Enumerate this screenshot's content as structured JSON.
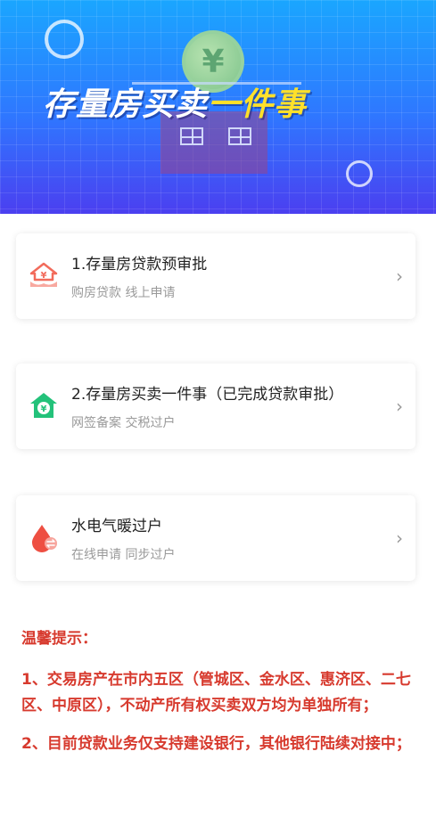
{
  "banner": {
    "title_main": "存量房买卖",
    "title_accent": "一件事",
    "icons": [
      "yuan-coin-icon",
      "house-icon"
    ]
  },
  "services": [
    {
      "title": "1.存量房贷款预审批",
      "subtitle": "购房贷款 线上申请",
      "icon": "house-loan-icon",
      "icon_color": "#f26b5b"
    },
    {
      "title": "2.存量房买卖一件事（已完成贷款审批）",
      "subtitle": "网签备案 交税过户",
      "icon": "house-yuan-icon",
      "icon_color": "#23c27a"
    },
    {
      "title": "水电气暖过户",
      "subtitle": "在线申请 同步过户",
      "icon": "drop-transfer-icon",
      "icon_color": "#ee4f42"
    }
  ],
  "tips": {
    "title": "温馨提示：",
    "items": [
      "1、交易房产在市内五区（管城区、金水区、惠济区、二七区、中原区），不动产所有权买卖双方均为单独所有；",
      "2、目前贷款业务仅支持建设银行，其他银行陆续对接中；"
    ],
    "color": "#d73a2e"
  },
  "chevron": "›"
}
